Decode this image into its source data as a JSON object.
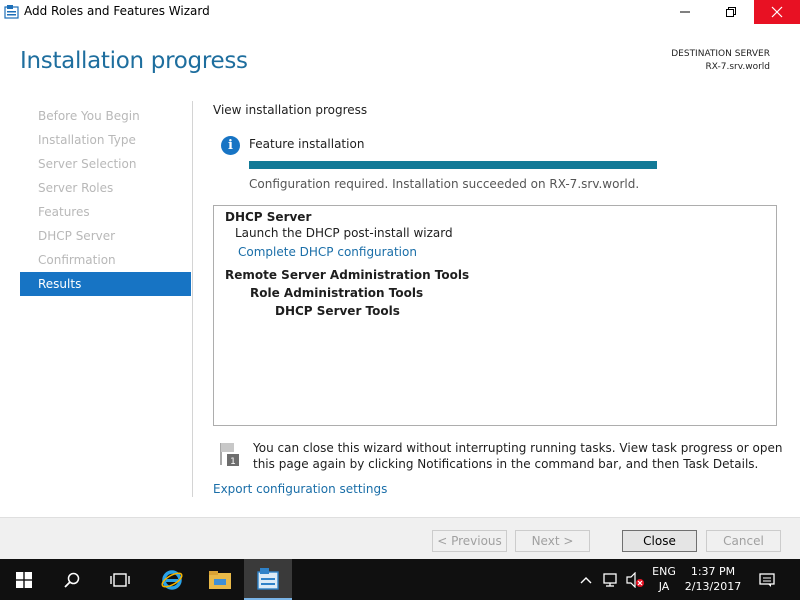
{
  "window": {
    "title": "Add Roles and Features Wizard",
    "icon": "server-wizard-icon"
  },
  "header": {
    "page_title": "Installation progress",
    "destination_label": "DESTINATION SERVER",
    "destination_value": "RX-7.srv.world"
  },
  "nav": {
    "items": [
      {
        "label": "Before You Begin",
        "active": false
      },
      {
        "label": "Installation Type",
        "active": false
      },
      {
        "label": "Server Selection",
        "active": false
      },
      {
        "label": "Server Roles",
        "active": false
      },
      {
        "label": "Features",
        "active": false
      },
      {
        "label": "DHCP Server",
        "active": false
      },
      {
        "label": "Confirmation",
        "active": false
      },
      {
        "label": "Results",
        "active": true
      }
    ]
  },
  "main": {
    "view_label": "View installation progress",
    "feature_label": "Feature installation",
    "progress": 1.0,
    "status_text": "Configuration required. Installation succeeded on RX-7.srv.world.",
    "results": [
      {
        "text": "DHCP Server",
        "style": "bold"
      },
      {
        "text": "Launch the DHCP post-install wizard",
        "style": "normal"
      },
      {
        "text": "Complete DHCP configuration",
        "style": "link"
      },
      {
        "text": "Remote Server Administration Tools",
        "style": "bold"
      },
      {
        "text": "Role Administration Tools",
        "style": "bold"
      },
      {
        "text": "DHCP Server Tools",
        "style": "bold"
      }
    ],
    "notice": "You can close this wizard without interrupting running tasks. View task progress or open this page again by clicking Notifications in the command bar, and then Task Details.",
    "notice_badge": "1",
    "export_link": "Export configuration settings"
  },
  "footer": {
    "previous": "< Previous",
    "next": "Next >",
    "close": "Close",
    "cancel": "Cancel"
  },
  "taskbar": {
    "language_line1": "ENG",
    "language_line2": "JA",
    "time": "1:37 PM",
    "date": "2/13/2017"
  },
  "colors": {
    "accent": "#1774c4",
    "title": "#1e6e9e",
    "progress": "#127a97",
    "link": "#1a6ea8",
    "close_button": "#e81123"
  }
}
